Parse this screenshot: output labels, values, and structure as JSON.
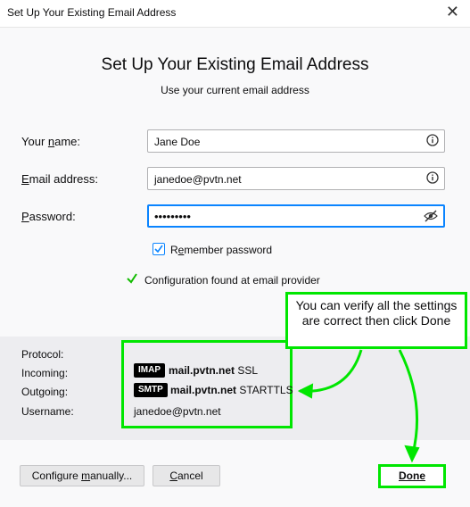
{
  "window": {
    "title": "Set Up Your Existing Email Address",
    "close_glyph": "✕"
  },
  "header": {
    "title": "Set Up Your Existing Email Address",
    "subtitle": "Use your current email address"
  },
  "form": {
    "name_label": "Your name:",
    "name_value": "Jane Doe",
    "email_label": "Email address:",
    "email_value": "janedoe@pvtn.net",
    "password_label": "Password:",
    "password_value": "•••••••••",
    "remember_label": "Remember password",
    "remember_checked": true
  },
  "status": {
    "text": "Configuration found at email provider"
  },
  "config": {
    "protocol_label": "Protocol:",
    "incoming_label": "Incoming:",
    "outgoing_label": "Outgoing:",
    "username_label": "Username:",
    "incoming_badge": "IMAP",
    "incoming_host": "mail.pvtn.net",
    "incoming_security": "SSL",
    "outgoing_badge": "SMTP",
    "outgoing_host": "mail.pvtn.net",
    "outgoing_security": "STARTTLS",
    "username": "janedoe@pvtn.net"
  },
  "callout": {
    "text": "You can verify all the settings are correct then click Done"
  },
  "buttons": {
    "configure": "Configure manually...",
    "cancel": "Cancel",
    "done": "Done"
  },
  "colors": {
    "annotation": "#00e600",
    "accent": "#0a84ff",
    "check": "#12bc00"
  }
}
